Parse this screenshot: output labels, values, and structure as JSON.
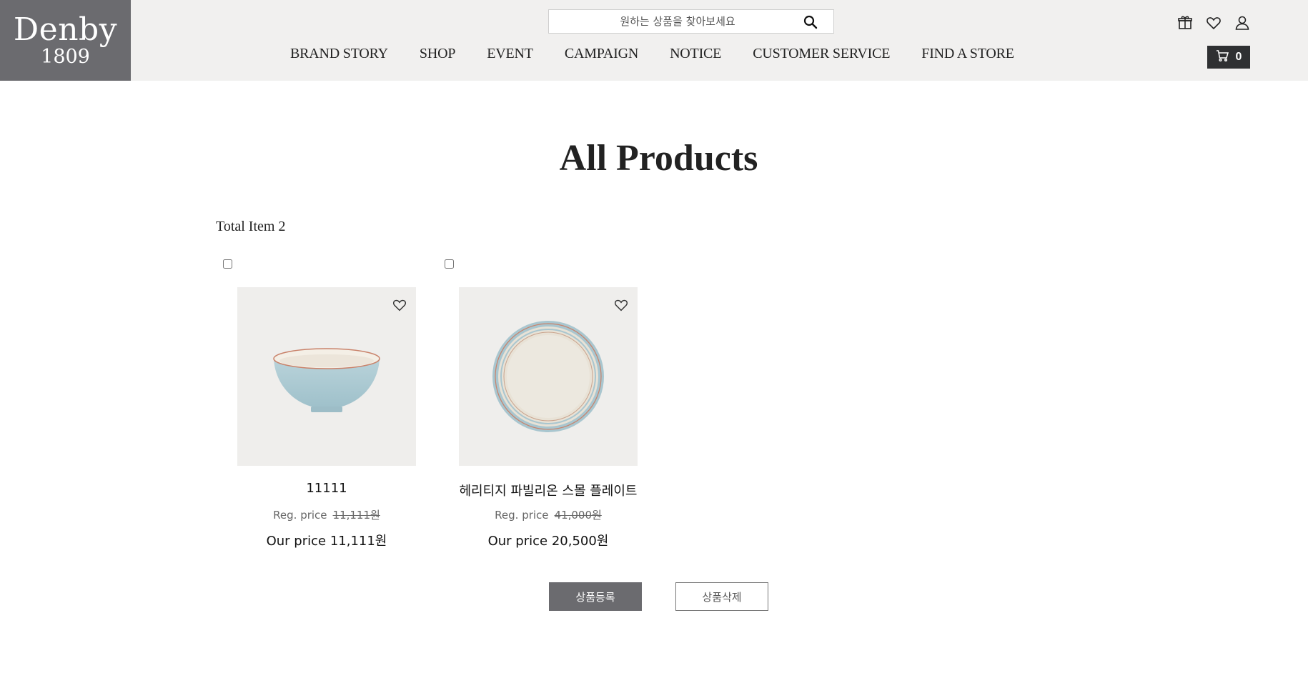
{
  "header": {
    "logo": {
      "brand": "Denby",
      "year": "1809"
    },
    "search": {
      "placeholder": "원하는 상품을 찾아보세요"
    },
    "nav": [
      "BRAND STORY",
      "SHOP",
      "EVENT",
      "CAMPAIGN",
      "NOTICE",
      "CUSTOMER SERVICE",
      "FIND A STORE"
    ],
    "icons": [
      "gift-icon",
      "heart-icon",
      "user-icon"
    ],
    "cart": {
      "count": "0",
      "icon": "cart-icon"
    }
  },
  "main": {
    "title": "All Products",
    "total_label": "Total Item 2",
    "products": [
      {
        "name": "11111",
        "reg_label": "Reg. price",
        "reg_price": "11,111원",
        "our_price": "Our price 11,111원",
        "image": "bowl"
      },
      {
        "name": "헤리티지 파빌리온 스몰 플레이트",
        "reg_label": "Reg. price",
        "reg_price": "41,000원",
        "our_price": "Our price 20,500원",
        "image": "plate"
      }
    ],
    "buttons": {
      "register": "상품등록",
      "delete": "상품삭제"
    }
  },
  "colors": {
    "header_bg": "#f1f0ef",
    "logo_bg": "#6b6b6f",
    "cart_bg": "#2f3032",
    "thumb_bg": "#efeeec"
  }
}
